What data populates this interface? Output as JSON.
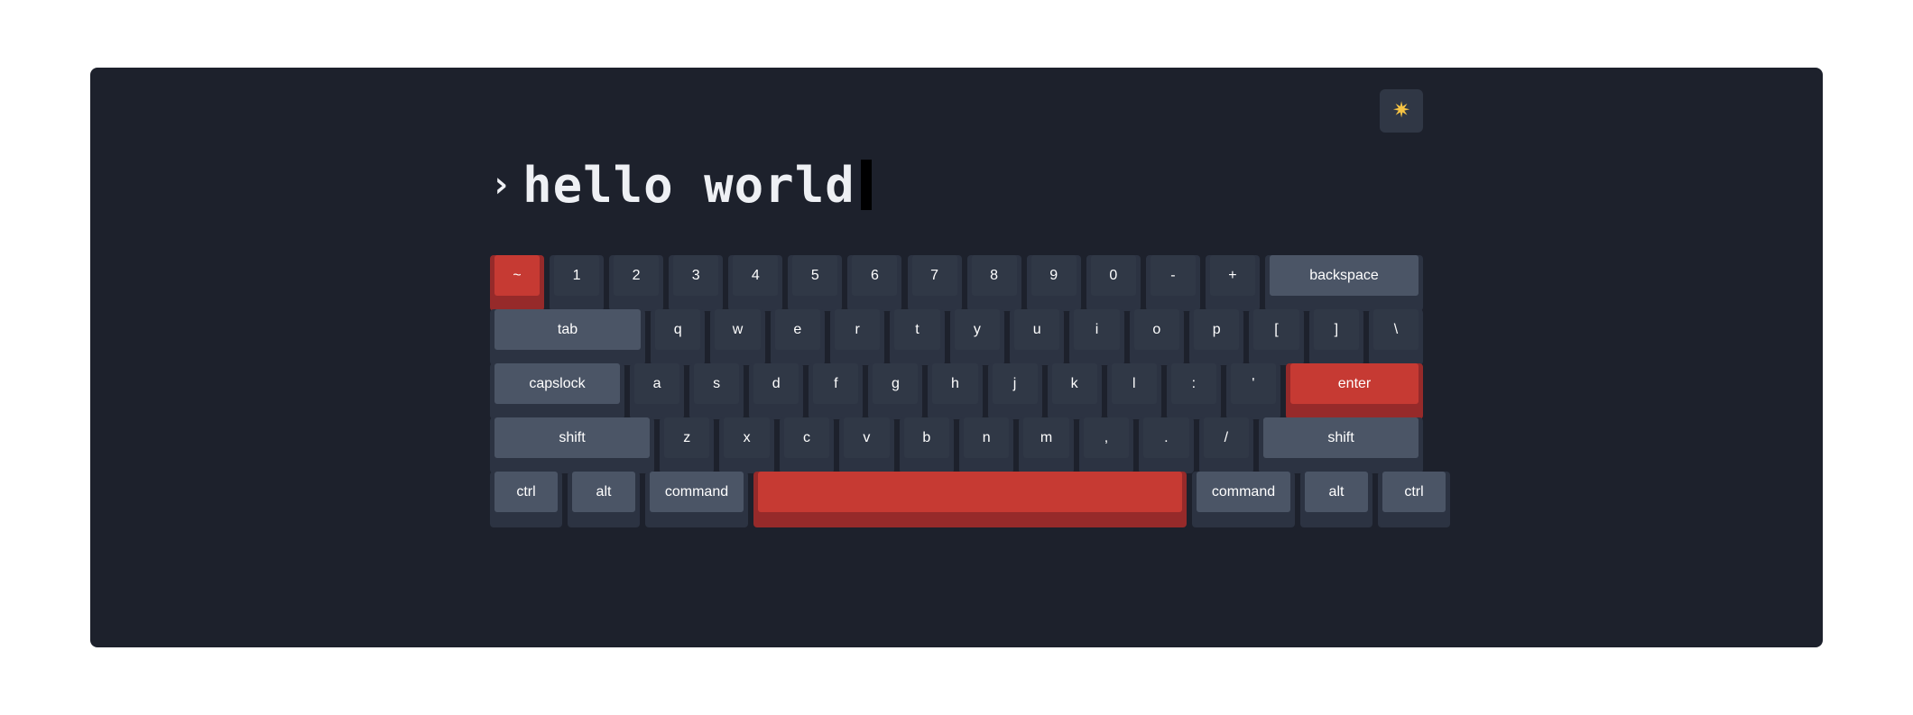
{
  "theme_toggle": {
    "icon": "sun-icon",
    "glyph": "✷"
  },
  "prompt": {
    "chevron": "›",
    "text": "hello world"
  },
  "colors": {
    "panel": "#1d212c",
    "key": "#303846",
    "modifier_key": "#4b5566",
    "accent_key": "#c63a33"
  },
  "keyboard": {
    "rows": [
      [
        {
          "label": "~",
          "accent": true
        },
        {
          "label": "1"
        },
        {
          "label": "2"
        },
        {
          "label": "3"
        },
        {
          "label": "4"
        },
        {
          "label": "5"
        },
        {
          "label": "6"
        },
        {
          "label": "7"
        },
        {
          "label": "8"
        },
        {
          "label": "9"
        },
        {
          "label": "0"
        },
        {
          "label": "-"
        },
        {
          "label": "+"
        },
        {
          "label": "backspace",
          "mod": true
        }
      ],
      [
        {
          "label": "tab",
          "mod": true
        },
        {
          "label": "q"
        },
        {
          "label": "w"
        },
        {
          "label": "e"
        },
        {
          "label": "r"
        },
        {
          "label": "t"
        },
        {
          "label": "y"
        },
        {
          "label": "u"
        },
        {
          "label": "i"
        },
        {
          "label": "o"
        },
        {
          "label": "p"
        },
        {
          "label": "["
        },
        {
          "label": "]"
        },
        {
          "label": "\\"
        }
      ],
      [
        {
          "label": "capslock",
          "mod": true
        },
        {
          "label": "a"
        },
        {
          "label": "s"
        },
        {
          "label": "d"
        },
        {
          "label": "f"
        },
        {
          "label": "g"
        },
        {
          "label": "h"
        },
        {
          "label": "j"
        },
        {
          "label": "k"
        },
        {
          "label": "l"
        },
        {
          "label": ":"
        },
        {
          "label": "'"
        },
        {
          "label": "enter",
          "accent": true
        }
      ],
      [
        {
          "label": "shift",
          "mod": true
        },
        {
          "label": "z"
        },
        {
          "label": "x"
        },
        {
          "label": "c"
        },
        {
          "label": "v"
        },
        {
          "label": "b"
        },
        {
          "label": "n"
        },
        {
          "label": "m"
        },
        {
          "label": ","
        },
        {
          "label": "."
        },
        {
          "label": "/"
        },
        {
          "label": "shift",
          "mod": true
        }
      ],
      [
        {
          "label": "ctrl",
          "mod": true
        },
        {
          "label": "alt",
          "mod": true
        },
        {
          "label": "command",
          "mod": true
        },
        {
          "label": "",
          "accent": true,
          "name": "spacebar"
        },
        {
          "label": "command",
          "mod": true
        },
        {
          "label": "alt",
          "mod": true
        },
        {
          "label": "ctrl",
          "mod": true
        }
      ]
    ]
  }
}
